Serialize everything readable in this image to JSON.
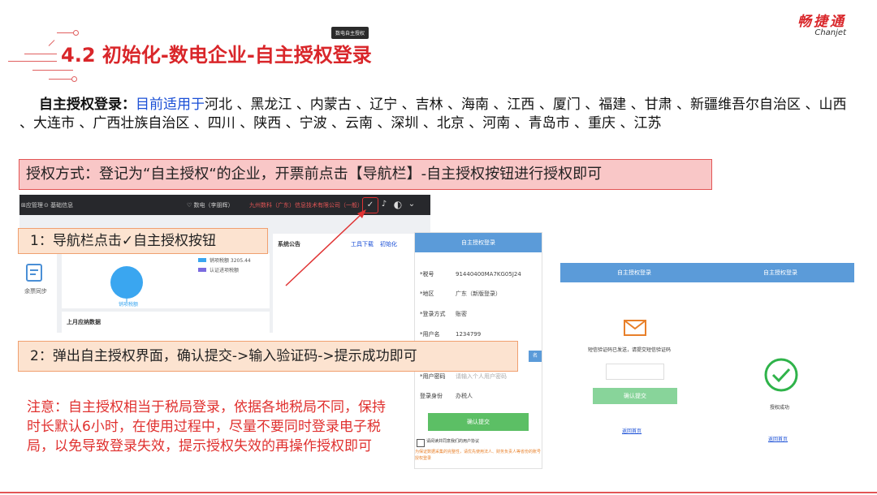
{
  "header": {
    "title": "4.2 初始化-数电企业-自主授权登录",
    "logo_cn": "畅捷通",
    "logo_en": "Chanjet"
  },
  "intro": {
    "lead": "自主授权登录：",
    "applies": "目前适用于",
    "regions": "河北 、黑龙江 、内蒙古 、辽宁 、吉林 、海南 、江西 、厦门 、福建 、甘肃 、新疆维吾尔自治区 、山西 、大连市 、广西壮族自治区 、四川 、陕西 、宁波 、云南 、深圳 、北京 、河南 、青岛市 、重庆 、江苏"
  },
  "method": "授权方式：登记为“自主授权“的企业，开票前点击【导航栏】-自主授权按钮进行授权即可",
  "app": {
    "nav_left_1": "⊞应管理",
    "nav_left_2": "⊙ 基础信息",
    "nav_mode": "♡ 数电（李朋辉）",
    "nav_company": "九州数科（广东）信息技术有限公司（一般）",
    "tooltip": "数电自主授权",
    "sync_label": "余票同步",
    "legend_1": "销项税额 3205.44",
    "legend_2": "认证进项税额",
    "pie_label": "销项税额",
    "monthly": "上月应纳数据",
    "notice": "系统公告",
    "tool_download": "工具下载",
    "init": "初始化"
  },
  "steps": {
    "step1": "1：导航栏点击✓自主授权按钮",
    "step2": "2：弹出自主授权界面，确认提交->输入验证码->提示成功即可"
  },
  "form": {
    "title": "自主授权登录",
    "rows": [
      {
        "k": "*税号",
        "v": "91440400MA7KG05J24"
      },
      {
        "k": "*地区",
        "v": "广东（新版登录）"
      },
      {
        "k": "*登录方式",
        "v": "账密"
      },
      {
        "k": "*用户名",
        "v": "1234799"
      },
      {
        "k": "*用户密码",
        "v": "请输入个人用户密码"
      },
      {
        "k": "登录身份",
        "v": "办税人"
      }
    ],
    "submit": "确认提交",
    "agree": "请阅读并同意我们的用户协议",
    "warning": "为保证数据采集的完整性，请优先使用法人、财务负责人等省份的账号授权登录",
    "sms_tag": "名"
  },
  "panel_verify": {
    "title": "自主授权登录",
    "sms_msg": "短信验证码已发送，请提交短信验证码",
    "confirm": "确认提交",
    "back": "返回首页"
  },
  "panel_success": {
    "title": "自主授权登录",
    "success": "授权成功",
    "back": "返回首页"
  },
  "note": "注意：自主授权相当于税局登录，依据各地税局不同，保持时长默认6小时，在使用过程中，尽量不要同时登录电子税局，以免导致登录失效，提示授权失效的再操作授权即可",
  "colors": {
    "accent_red": "#d9262a",
    "form_blue": "#5b9bd9",
    "success_green": "#5cbf65",
    "link_blue": "#1a4fd6"
  }
}
